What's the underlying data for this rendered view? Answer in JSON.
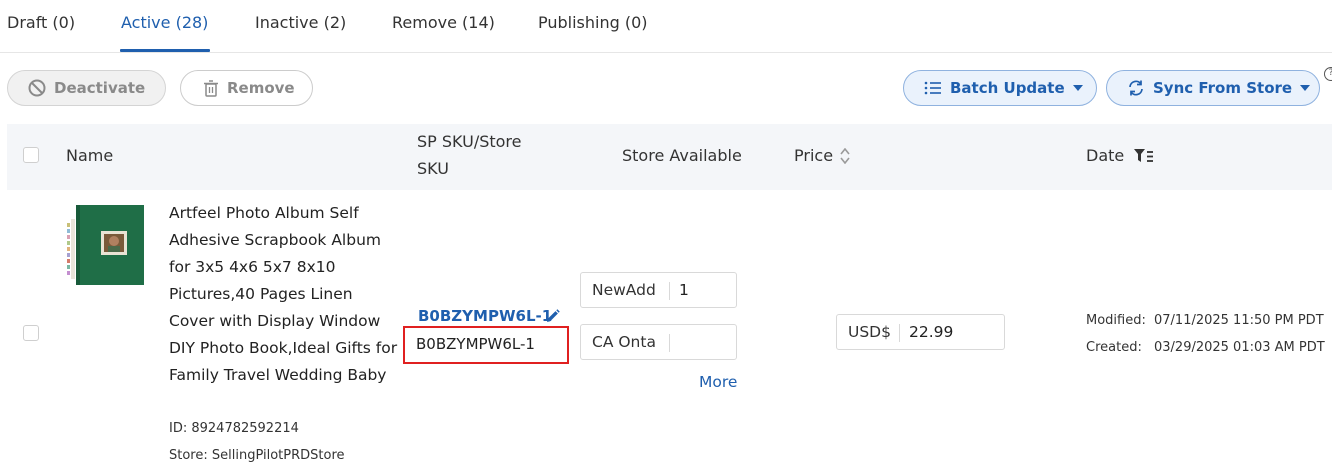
{
  "tabs": [
    {
      "label": "Draft (0)"
    },
    {
      "label": "Active (28)"
    },
    {
      "label": "Inactive (2)"
    },
    {
      "label": "Remove (14)"
    },
    {
      "label": "Publishing (0)"
    }
  ],
  "actions": {
    "deactivate": "Deactivate",
    "remove": "Remove",
    "batch_update": "Batch Update",
    "sync_from_store": "Sync From Store"
  },
  "table": {
    "headers": {
      "name": "Name",
      "sku_line1": "SP SKU/Store",
      "sku_line2": "SKU",
      "store_available": "Store Available",
      "price": "Price",
      "date": "Date"
    }
  },
  "product": {
    "name": "Artfeel Photo Album Self Adhesive Scrapbook Album for 3x5 4x6 5x7 8x10 Pictures,40 Pages Linen Cover with Display Window DIY Photo Book,Ideal Gifts for Family Travel Wedding Baby",
    "id": "ID: 8924782592214",
    "store": "Store: SellingPilotPRDStore",
    "sp_sku": "B0BZYMPW6L-1",
    "store_sku": "B0BZYMPW6L-1",
    "stores": [
      {
        "name": "NewAdd",
        "qty": "1"
      },
      {
        "name": "CA Onta",
        "qty": ""
      }
    ],
    "more": "More",
    "currency": "USD$",
    "price": "22.99",
    "modified_label": "Modified:",
    "modified": "07/11/2025 11:50 PM PDT",
    "created_label": "Created:",
    "created": "03/29/2025 01:03 AM PDT"
  },
  "colors": {
    "accent": "#1f5fae",
    "highlight": "#e02020",
    "album_cover": "#1f6e47"
  }
}
